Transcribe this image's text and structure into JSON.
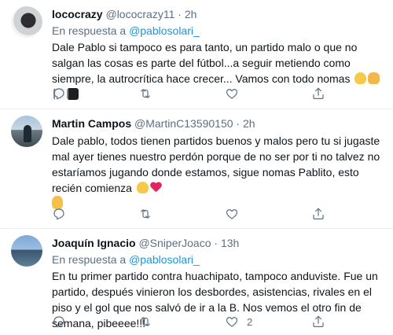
{
  "tweets": [
    {
      "name": "lococrazy",
      "handle": "@lococrazy11",
      "time": "2h",
      "reply_prefix": "En respuesta a",
      "reply_to": "@pablosolari_",
      "text": "Dale Pablo si tampoco es para tanto, un partido malo o que no salgan las cosas es parte del fútbol...a seguir metiendo como siempre, la autrocrítica hace crecer... Vamos con todo nomas",
      "emojis": [
        "flexed-biceps",
        "thumbs-up",
        "white-flag",
        "black-flag"
      ],
      "like_count": ""
    },
    {
      "name": "Martin Campos",
      "handle": "@MartinC13590150",
      "time": "2h",
      "text": "Dale pablo, todos tienen partidos buenos y malos pero tu si jugaste mal ayer tienes nuestro perdón porque de no ser por ti no talvez no estaríamos jugando donde estamos, sigue nomas Pablito, esto recién comienza",
      "emojis": [
        "flexed-biceps",
        "red-heart",
        "sign-of-the-horns"
      ],
      "like_count": ""
    },
    {
      "name": "Joaquín Ignacio",
      "handle": "@SniperJoaco",
      "time": "13h",
      "reply_prefix": "En respuesta a",
      "reply_to": "@pablosolari_",
      "text": "En tu primer partido contra huachipato, tampoco anduviste. Fue un partido, después vinieron los desbordes, asistencias, rivales en el piso y el gol que nos salvó de ir a la B. Nos vemos el otro fin de semana, pibeeee!!!",
      "like_count": "2"
    }
  ],
  "separators": {
    "dot": "·"
  },
  "icons": {
    "reply": "reply-icon",
    "retweet": "retweet-icon",
    "like": "like-icon",
    "share": "share-icon"
  },
  "colors": {
    "accent": "#1b95e0",
    "secondary_text": "#5b7083",
    "divider": "#ebeef0"
  }
}
